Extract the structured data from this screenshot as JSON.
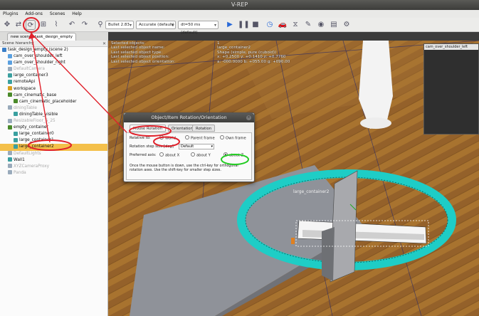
{
  "app": {
    "title": "V-REP"
  },
  "menu": [
    "Plugins",
    "Add-ons",
    "Scenes",
    "Help"
  ],
  "toolbar": {
    "engine": "Bullet 2.83",
    "accuracy": "Accurate (default)",
    "dt": "dt=50 ms (default)"
  },
  "tabs": [
    "new scene",
    "task_design_empty"
  ],
  "hierarchy": {
    "title": "Scene hierarchy",
    "items": [
      {
        "label": "task_design_empty (scene 2)",
        "indent": 0,
        "color": "#3a7ec8",
        "dim": false,
        "sel": false
      },
      {
        "label": "cam_over_shoulder_left",
        "indent": 1,
        "color": "#5aa0e0",
        "dim": false,
        "sel": false
      },
      {
        "label": "cam_over_shoulder_right",
        "indent": 1,
        "color": "#5aa0e0",
        "dim": false,
        "sel": false
      },
      {
        "label": "DefaultCamera",
        "indent": 1,
        "color": "#9ab",
        "dim": true,
        "sel": false
      },
      {
        "label": "large_container3",
        "indent": 1,
        "color": "#3aa0a0",
        "dim": false,
        "sel": false
      },
      {
        "label": "remoteApi",
        "indent": 1,
        "color": "#3aa0a0",
        "dim": false,
        "sel": false
      },
      {
        "label": "workspace",
        "indent": 1,
        "color": "#d8a020",
        "dim": false,
        "sel": false
      },
      {
        "label": "cam_cinematic_base",
        "indent": 1,
        "color": "#4a8a2a",
        "dim": false,
        "sel": false
      },
      {
        "label": "cam_cinematic_placeholder",
        "indent": 2,
        "color": "#4a8a2a",
        "dim": false,
        "sel": false
      },
      {
        "label": "diningTable",
        "indent": 1,
        "color": "#9ab",
        "dim": true,
        "sel": false
      },
      {
        "label": "diningTable_visible",
        "indent": 2,
        "color": "#3aa0a0",
        "dim": false,
        "sel": false
      },
      {
        "label": "ResizableFloor_5_25",
        "indent": 1,
        "color": "#9ab",
        "dim": true,
        "sel": false
      },
      {
        "label": "empty_container",
        "indent": 1,
        "color": "#4a8a2a",
        "dim": false,
        "sel": false
      },
      {
        "label": "large_container0",
        "indent": 2,
        "color": "#3aa0a0",
        "dim": false,
        "sel": false
      },
      {
        "label": "large_container1",
        "indent": 2,
        "color": "#3aa0a0",
        "dim": false,
        "sel": false
      },
      {
        "label": "large_container2",
        "indent": 2,
        "color": "#3aa0a0",
        "dim": false,
        "sel": true
      },
      {
        "label": "DefaultLights",
        "indent": 1,
        "color": "#9ab",
        "dim": true,
        "sel": false
      },
      {
        "label": "Wall1",
        "indent": 1,
        "color": "#3aa0a0",
        "dim": false,
        "sel": false
      },
      {
        "label": "XYZCameraProxy",
        "indent": 1,
        "color": "#9ab",
        "dim": true,
        "sel": false
      },
      {
        "label": "Panda",
        "indent": 1,
        "color": "#9ab",
        "dim": true,
        "sel": false
      }
    ]
  },
  "info_labels": [
    "Selected objects:",
    "Last selected object name:",
    "Last selected object type:",
    "Last selected object position:",
    "Last selected object orientation:"
  ],
  "info_values": [
    "1",
    "large_container2",
    "Shape (simple, pure (cuboid))",
    "x: +0.2500   y: +0.1410   z: +0.7760",
    "a: -000.0000   b: +055.00   g: +090.00"
  ],
  "camera_view": {
    "title": "cam_over_shoulder_left"
  },
  "object_label": "large_container2",
  "dialog": {
    "title": "Object/Item Rotation/Orientation",
    "tabs": [
      "Mouse Rotation",
      "Orientation",
      "Rotation"
    ],
    "relative_to": "Relative to:",
    "world": "World",
    "parent_frame": "Parent frame",
    "own_frame": "Own frame",
    "step_label": "Rotation step size [deg]",
    "step_value": "Default",
    "pref_axis": "Preferred axis:",
    "about_x": "about X",
    "about_y": "about Y",
    "about_z": "about Z",
    "note": "Once the mouse button is down, use the ctrl-key for orthogonal rotation axes. Use the shift-key for smaller step sizes."
  },
  "colors": {
    "accent_red": "#e0202a",
    "accent_green": "#22cc22",
    "rotation_ring": "#1ecdc6",
    "floor": "#9b6a2c"
  }
}
